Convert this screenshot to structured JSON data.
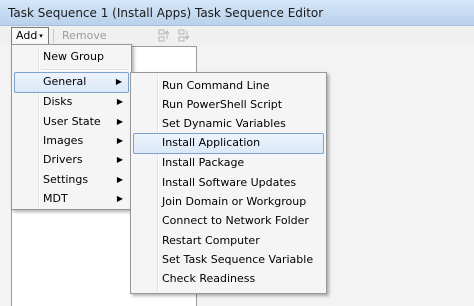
{
  "window": {
    "title": "Task Sequence 1 (Install Apps) Task Sequence Editor"
  },
  "toolbar": {
    "add_label": "Add",
    "add_arrow": "▾",
    "remove_label": "Remove",
    "icons": [
      "move-up-icon",
      "move-down-icon"
    ]
  },
  "add_menu": {
    "items": [
      {
        "label": "New Group",
        "arrow": ""
      },
      {
        "label": "General",
        "arrow": "▶"
      },
      {
        "label": "Disks",
        "arrow": "▶"
      },
      {
        "label": "User State",
        "arrow": "▶"
      },
      {
        "label": "Images",
        "arrow": "▶"
      },
      {
        "label": "Drivers",
        "arrow": "▶"
      },
      {
        "label": "Settings",
        "arrow": "▶"
      },
      {
        "label": "MDT",
        "arrow": "▶"
      }
    ],
    "active_item": "General"
  },
  "general_submenu": {
    "items": [
      {
        "label": "Run Command Line"
      },
      {
        "label": "Run PowerShell Script"
      },
      {
        "label": "Set Dynamic Variables"
      },
      {
        "label": "Install Application"
      },
      {
        "label": "Install Package"
      },
      {
        "label": "Install Software Updates"
      },
      {
        "label": "Join Domain or Workgroup"
      },
      {
        "label": "Connect to Network Folder"
      },
      {
        "label": "Restart Computer"
      },
      {
        "label": "Set Task Sequence Variable"
      },
      {
        "label": "Check Readiness"
      }
    ],
    "highlighted_item": "Install Application"
  },
  "colors": {
    "highlight_border": "#7da2ce",
    "highlight_fill": "#dbe8f8",
    "disabled_text": "#9c9c9c"
  }
}
